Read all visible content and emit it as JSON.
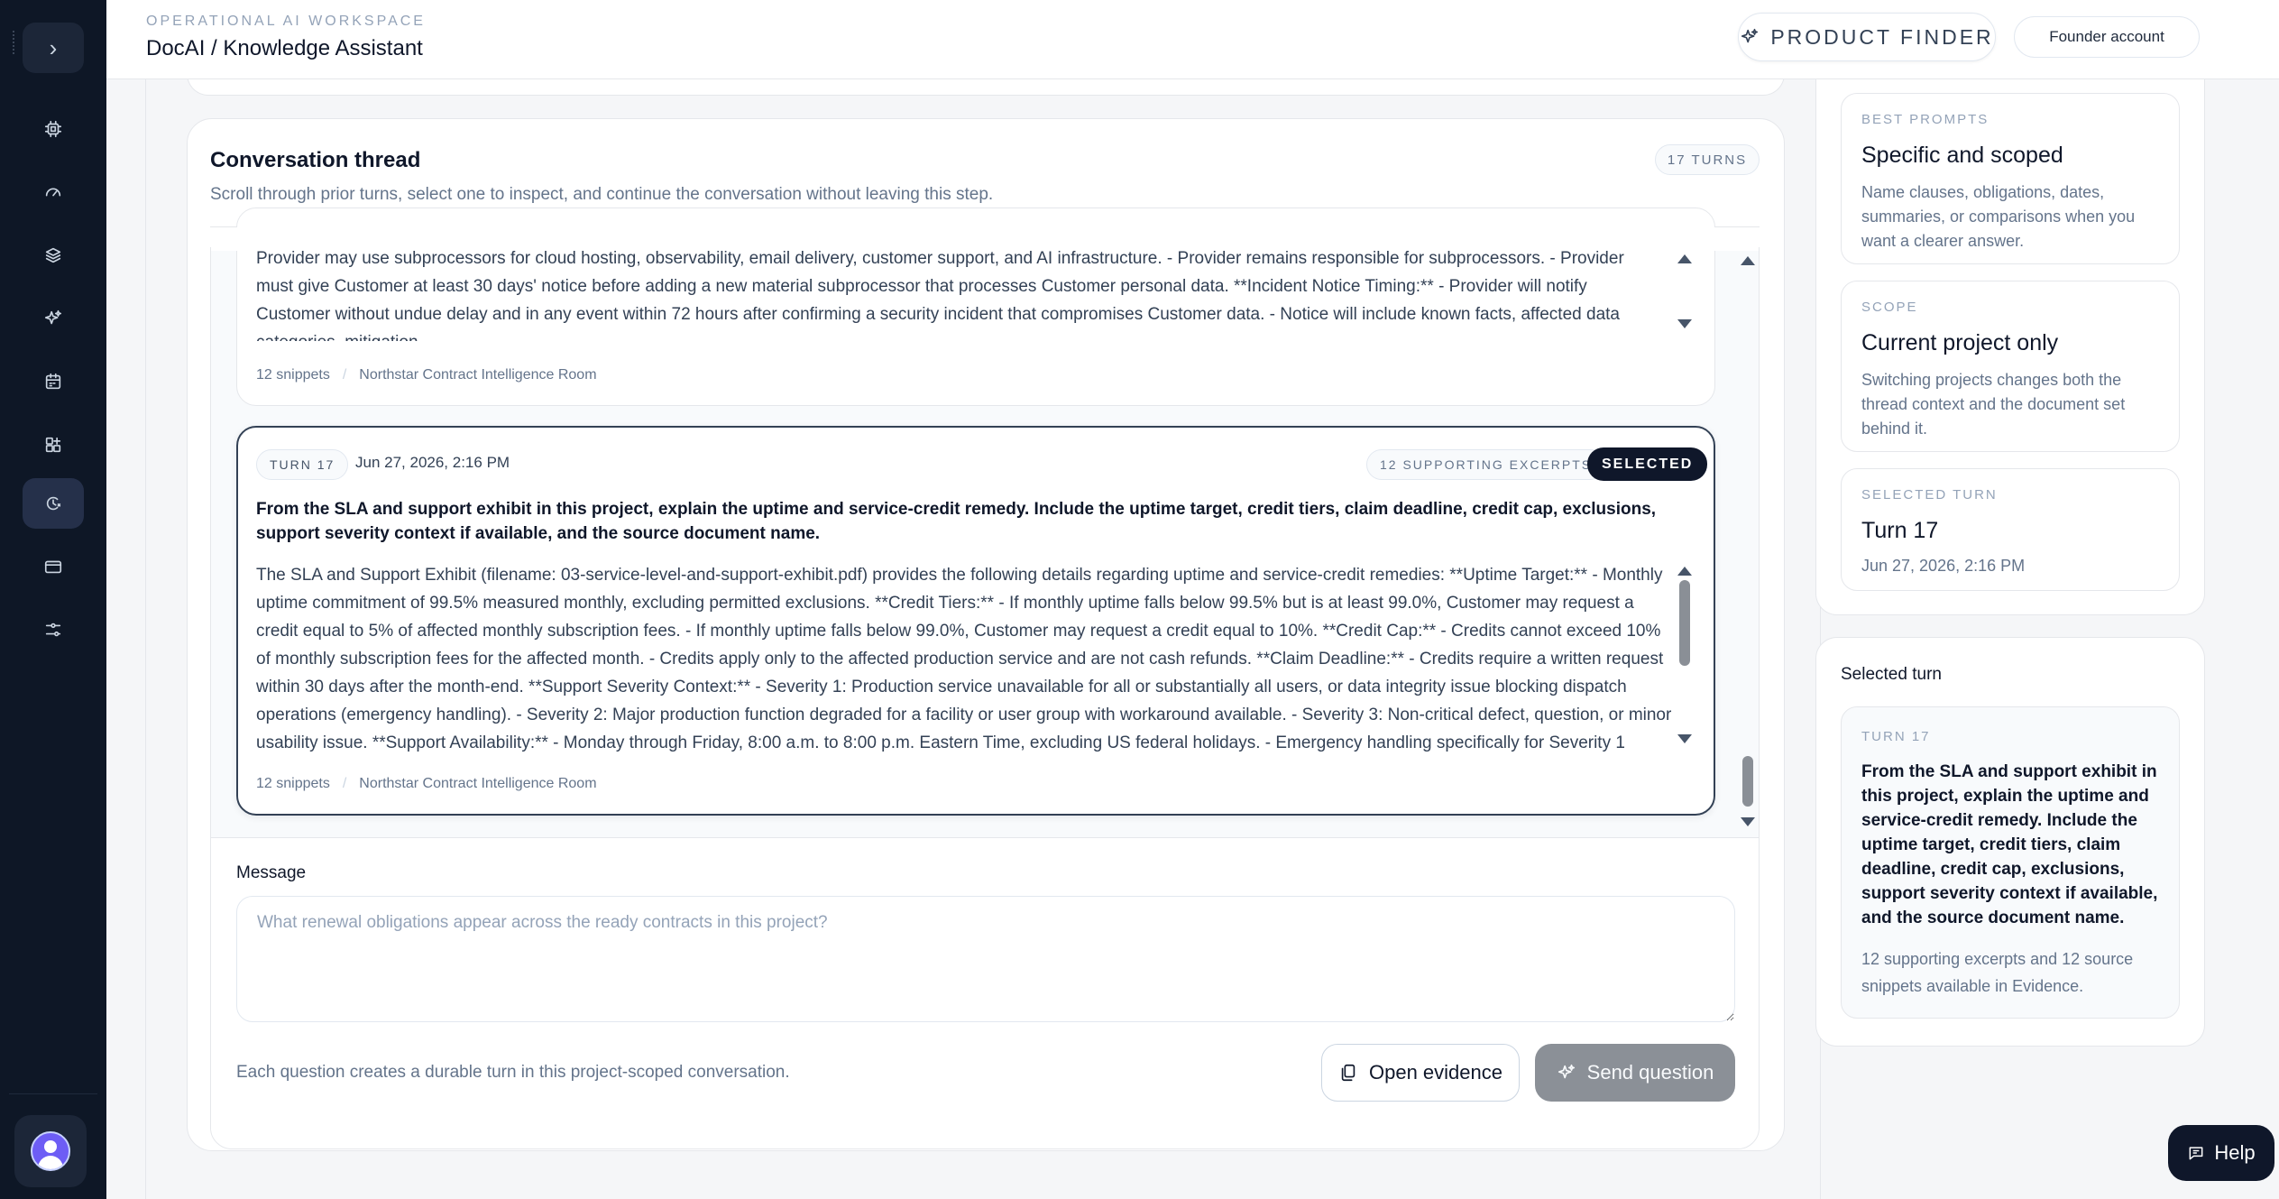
{
  "header": {
    "eyebrow": "OPERATIONAL AI WORKSPACE",
    "title": "DocAI / Knowledge Assistant",
    "product_finder_label": "PRODUCT FINDER",
    "account_label": "Founder account"
  },
  "rail": {
    "toggle_icon": "chevron-right-icon",
    "items": [
      {
        "icon": "chip-icon",
        "active": false
      },
      {
        "icon": "gauge-icon",
        "active": false
      },
      {
        "icon": "layers-icon",
        "active": false
      },
      {
        "icon": "sparkles-icon",
        "active": false
      },
      {
        "icon": "calendar-icon",
        "active": false
      },
      {
        "icon": "grid-plus-icon",
        "active": false
      },
      {
        "icon": "assistant-icon",
        "active": true
      },
      {
        "icon": "card-icon",
        "active": false
      },
      {
        "icon": "sliders-icon",
        "active": false
      }
    ]
  },
  "thread": {
    "title": "Conversation thread",
    "subtitle": "Scroll through prior turns, select one to inspect, and continue the conversation without leaving this step.",
    "turns_badge": "17 TURNS",
    "previous_turn": {
      "answer": "procedures, secure software development practices, backup monitoring, and vulnerability remediation processes proportional to service risk are maintained. **Subprocessors:** - Provider may use subprocessors for cloud hosting, observability, email delivery, customer support, and AI infrastructure. - Provider remains responsible for subprocessors. - Provider must give Customer at least 30 days' notice before adding a new material subprocessor that processes Customer personal data. **Incident Notice Timing:** - Provider will notify Customer without undue delay and in any event within 72 hours after confirming a security incident that compromises Customer data. - Notice will include known facts, affected data categories, mitigation",
      "snippets": "12 snippets",
      "separator": "/",
      "room": "Northstar Contract Intelligence Room"
    },
    "selected_turn": {
      "turn_label": "TURN 17",
      "date": "Jun 27, 2026, 2:16 PM",
      "excerpts_label": "12 SUPPORTING EXCERPTS",
      "selected_label": "SELECTED",
      "question": "From the SLA and support exhibit in this project, explain the uptime and service-credit remedy. Include the uptime target, credit tiers, claim deadline, credit cap, exclusions, support severity context if available, and the source document name.",
      "answer": "The SLA and Support Exhibit (filename: 03-service-level-and-support-exhibit.pdf) provides the following details regarding uptime and service-credit remedies: **Uptime Target:** - Monthly uptime commitment of 99.5% measured monthly, excluding permitted exclusions. **Credit Tiers:** - If monthly uptime falls below 99.5% but is at least 99.0%, Customer may request a credit equal to 5% of affected monthly subscription fees. - If monthly uptime falls below 99.0%, Customer may request a credit equal to 10%. **Credit Cap:** - Credits cannot exceed 10% of monthly subscription fees for the affected month. - Credits apply only to the affected production service and are not cash refunds. **Claim Deadline:** - Credits require a written request within 30 days after the month-end. **Support Severity Context:** - Severity 1: Production service unavailable for all or substantially all users, or data integrity issue blocking dispatch operations (emergency handling). - Severity 2: Major production function degraded for a facility or user group with workaround available. - Severity 3: Non-critical defect, question, or minor usability issue. **Support Availability:** - Monday through Friday, 8:00 a.m. to 8:00 p.m. Eastern Time, excluding US federal holidays. - Emergency handling specifically for Severity 1",
      "snippets": "12 snippets",
      "separator": "/",
      "room": "Northstar Contract Intelligence Room"
    }
  },
  "compose": {
    "label": "Message",
    "placeholder": "What renewal obligations appear across the ready contracts in this project?",
    "value": "",
    "note": "Each question creates a durable turn in this project-scoped conversation.",
    "open_evidence_label": "Open evidence",
    "send_label": "Send question"
  },
  "side": {
    "tips": [
      {
        "eyebrow": "BEST PROMPTS",
        "title": "Specific and scoped",
        "body": "Name clauses, obligations, dates, summaries, or comparisons when you want a clearer answer."
      },
      {
        "eyebrow": "SCOPE",
        "title": "Current project only",
        "body": "Switching projects changes both the thread context and the document set behind it."
      },
      {
        "eyebrow": "SELECTED TURN",
        "title": "Turn 17",
        "body": "Jun 27, 2026, 2:16 PM"
      }
    ],
    "selected": {
      "heading": "Selected turn",
      "turn_label": "TURN 17",
      "question": "From the SLA and support exhibit in this project, explain the uptime and service-credit remedy. Include the uptime target, credit tiers, claim deadline, credit cap, exclusions, support severity context if available, and the source document name.",
      "footer": "12 supporting excerpts and 12 source snippets available in Evidence."
    }
  },
  "help_label": "Help"
}
